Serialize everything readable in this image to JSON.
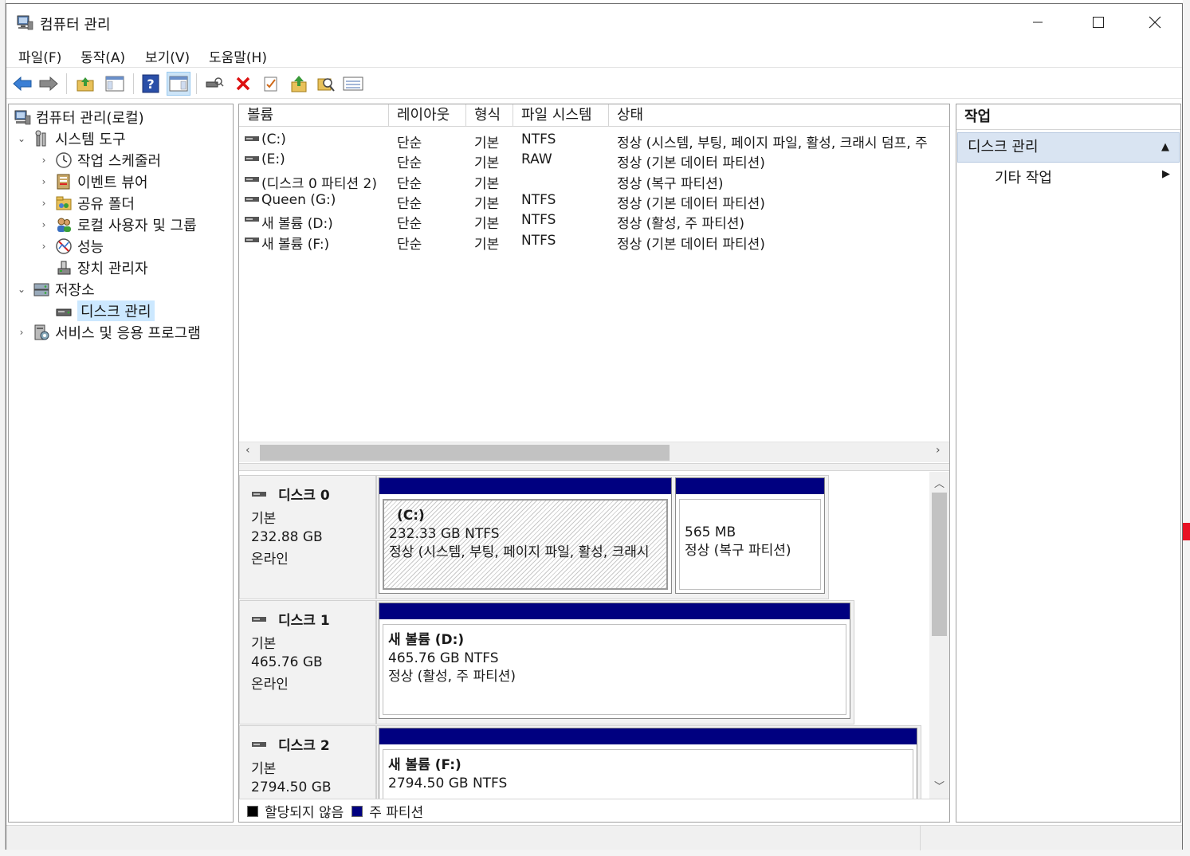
{
  "window": {
    "title": "컴퓨터 관리"
  },
  "menu": [
    "파일(F)",
    "동작(A)",
    "보기(V)",
    "도움말(H)"
  ],
  "tree": {
    "root": "컴퓨터 관리(로컬)",
    "system_tools": "시스템 도구",
    "task_scheduler": "작업 스케줄러",
    "event_viewer": "이벤트 뷰어",
    "shared_folders": "공유 폴더",
    "local_users": "로컬 사용자 및 그룹",
    "performance": "성능",
    "device_manager": "장치 관리자",
    "storage": "저장소",
    "disk_management": "디스크 관리",
    "services": "서비스 및 응용 프로그램"
  },
  "volumes": {
    "columns": [
      "볼륨",
      "레이아웃",
      "형식",
      "파일 시스템",
      "상태"
    ],
    "rows": [
      {
        "volume": "(C:)",
        "layout": "단순",
        "type": "기본",
        "fs": "NTFS",
        "status": "정상 (시스템, 부팅, 페이지 파일, 활성, 크래시 덤프, 주"
      },
      {
        "volume": "(E:)",
        "layout": "단순",
        "type": "기본",
        "fs": "RAW",
        "status": "정상 (기본 데이터 파티션)"
      },
      {
        "volume": "(디스크 0 파티션 2)",
        "layout": "단순",
        "type": "기본",
        "fs": "",
        "status": "정상 (복구 파티션)"
      },
      {
        "volume": "Queen (G:)",
        "layout": "단순",
        "type": "기본",
        "fs": "NTFS",
        "status": "정상 (기본 데이터 파티션)"
      },
      {
        "volume": "새 볼륨 (D:)",
        "layout": "단순",
        "type": "기본",
        "fs": "NTFS",
        "status": "정상 (활성, 주 파티션)"
      },
      {
        "volume": "새 볼륨 (F:)",
        "layout": "단순",
        "type": "기본",
        "fs": "NTFS",
        "status": "정상 (기본 데이터 파티션)"
      }
    ]
  },
  "disks": [
    {
      "name": "디스크 0",
      "kind": "기본",
      "size": "232.88 GB",
      "state": "온라인",
      "partitions": [
        {
          "title": "(C:)",
          "size": "232.33 GB NTFS",
          "status": "정상 (시스템, 부팅, 페이지 파일, 활성, 크래시"
        },
        {
          "title": "",
          "size": "565 MB",
          "status": "정상 (복구 파티션)"
        }
      ]
    },
    {
      "name": "디스크 1",
      "kind": "기본",
      "size": "465.76 GB",
      "state": "온라인",
      "partitions": [
        {
          "title": "새 볼륨  (D:)",
          "size": "465.76 GB NTFS",
          "status": "정상 (활성, 주 파티션)"
        }
      ]
    },
    {
      "name": "디스크 2",
      "kind": "기본",
      "size": "2794.50 GB",
      "state": "",
      "partitions": [
        {
          "title": "새 볼륨  (F:)",
          "size": "2794.50 GB NTFS",
          "status": ""
        }
      ]
    }
  ],
  "legend": {
    "unallocated": "할당되지 않음",
    "primary": "주 파티션",
    "unallocated_color": "#000000",
    "primary_color": "#000080"
  },
  "actions": {
    "title": "작업",
    "section": "디스크 관리",
    "more": "기타 작업"
  }
}
